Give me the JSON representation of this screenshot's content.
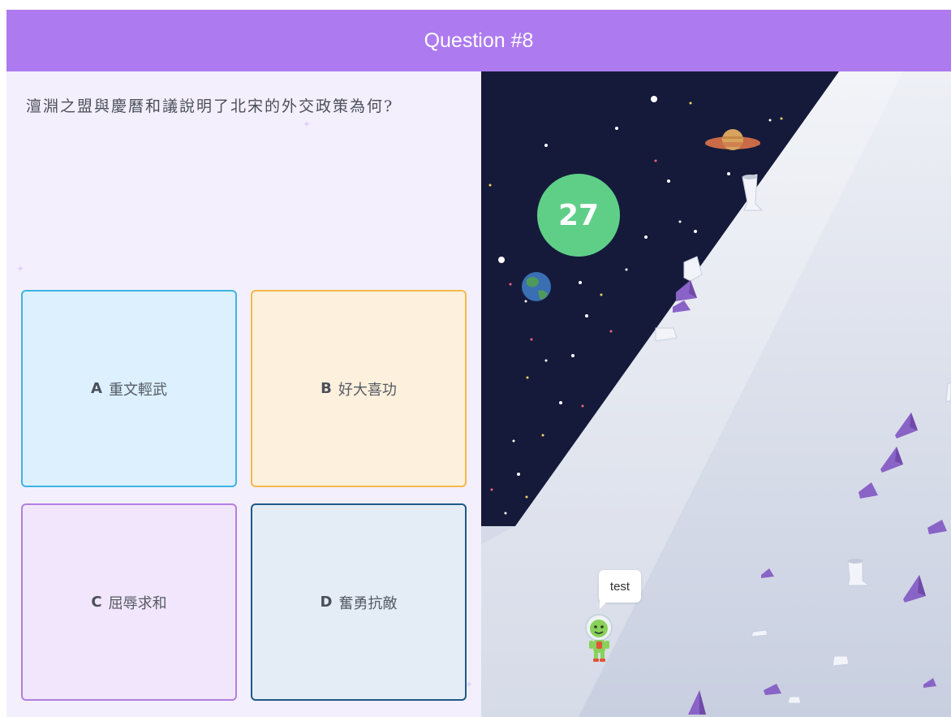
{
  "header": {
    "title": "Question #8"
  },
  "question": {
    "text": "澶淵之盟與慶曆和議說明了北宋的外交政策為何?"
  },
  "answers": [
    {
      "letter": "A",
      "text": "重文輕武",
      "color": "#3eb4e4"
    },
    {
      "letter": "B",
      "text": "好大喜功",
      "color": "#f5b84a"
    },
    {
      "letter": "C",
      "text": "屈辱求和",
      "color": "#b380df"
    },
    {
      "letter": "D",
      "text": "奮勇抗敵",
      "color": "#1f5a86"
    }
  ],
  "game": {
    "timer": "27",
    "player_name": "test",
    "icons": [
      "saturn-icon",
      "earth-icon",
      "astronaut-avatar-icon",
      "crystal-rock-icon",
      "tree-stump-icon"
    ],
    "colors": {
      "space": "#151a3b",
      "slope": "#e6eaf3",
      "timer": "#5fcf88",
      "crystal": "#8a63c7"
    }
  }
}
